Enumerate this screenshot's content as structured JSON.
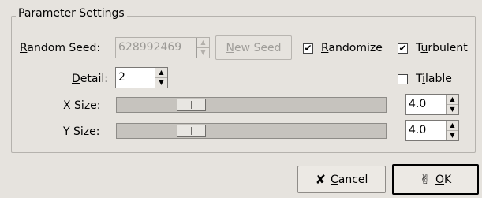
{
  "frame": {
    "title": "Parameter Settings"
  },
  "random_seed": {
    "label_mnemonic": "R",
    "label_rest": "andom Seed:",
    "value": "628992469",
    "new_seed_label_mnemonic": "N",
    "new_seed_label_rest": "ew Seed"
  },
  "randomize": {
    "label_mnemonic": "R",
    "label_rest": "andomize",
    "checked": true,
    "mark": "✔"
  },
  "turbulent": {
    "label_before": "T",
    "label_mnemonic": "u",
    "label_rest": "rbulent",
    "checked": true,
    "mark": "✔"
  },
  "detail": {
    "label_mnemonic": "D",
    "label_rest": "etail:",
    "value": "2"
  },
  "tilable": {
    "label_before": "T",
    "label_mnemonic": "i",
    "label_rest": "lable",
    "checked": false
  },
  "x_size": {
    "label_mnemonic": "X",
    "label_rest": " Size:",
    "value": "4.0",
    "slider_fraction": 0.25
  },
  "y_size": {
    "label_mnemonic": "Y",
    "label_rest": " Size:",
    "value": "4.0",
    "slider_fraction": 0.25
  },
  "spin_arrows": {
    "up": "▲",
    "down": "▼"
  },
  "buttons": {
    "cancel_mnemonic": "C",
    "cancel_rest": "ancel",
    "cancel_icon": "✘",
    "ok_mnemonic": "O",
    "ok_rest": "K",
    "ok_icon": "✌"
  }
}
